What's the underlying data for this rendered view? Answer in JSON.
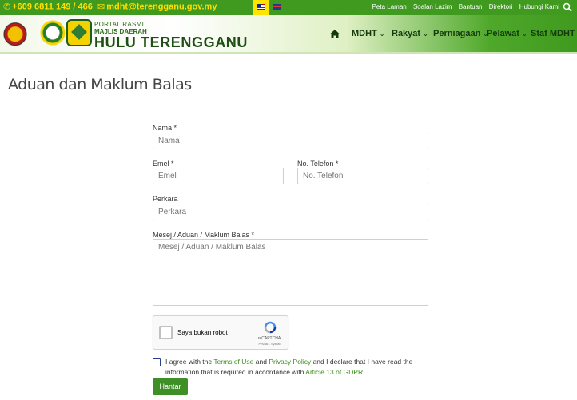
{
  "topbar": {
    "phone": "+609 6811 149 / 466",
    "email": "mdht@terengganu.gov.my",
    "links": [
      "Peta Laman",
      "Soalan Lazim",
      "Bantuan",
      "Direktori",
      "Hubungi Kami"
    ]
  },
  "brand": {
    "line1": "PORTAL RASMI",
    "line2": "MAJLIS DAERAH",
    "line3": "HULU TERENGGANU"
  },
  "nav": {
    "items": [
      "MDHT",
      "Rakyat",
      "Perniagaan",
      "Pelawat",
      "Staf MDHT"
    ]
  },
  "page": {
    "title": "Aduan dan Maklum Balas"
  },
  "form": {
    "name_label": "Nama *",
    "name_placeholder": "Nama",
    "email_label": "Emel *",
    "email_placeholder": "Emel",
    "phone_label": "No. Telefon *",
    "phone_placeholder": "No. Telefon",
    "subject_label": "Perkara",
    "subject_placeholder": "Perkara",
    "message_label": "Mesej / Aduan / Maklum Balas *",
    "message_placeholder": "Mesej / Aduan / Maklum Balas",
    "captcha_text": "Saya bukan robot",
    "captcha_brand": "reCAPTCHA",
    "captcha_sub": "Privasi - Syarat",
    "agree_pre": "I agree with the ",
    "agree_terms": "Terms of Use",
    "agree_and": " and ",
    "agree_privacy": "Privacy Policy",
    "agree_mid": " and I declare that I have read the information that is required in accordance with ",
    "agree_article": "Article 13 of GDPR",
    "agree_end": ".",
    "submit_label": "Hantar"
  }
}
